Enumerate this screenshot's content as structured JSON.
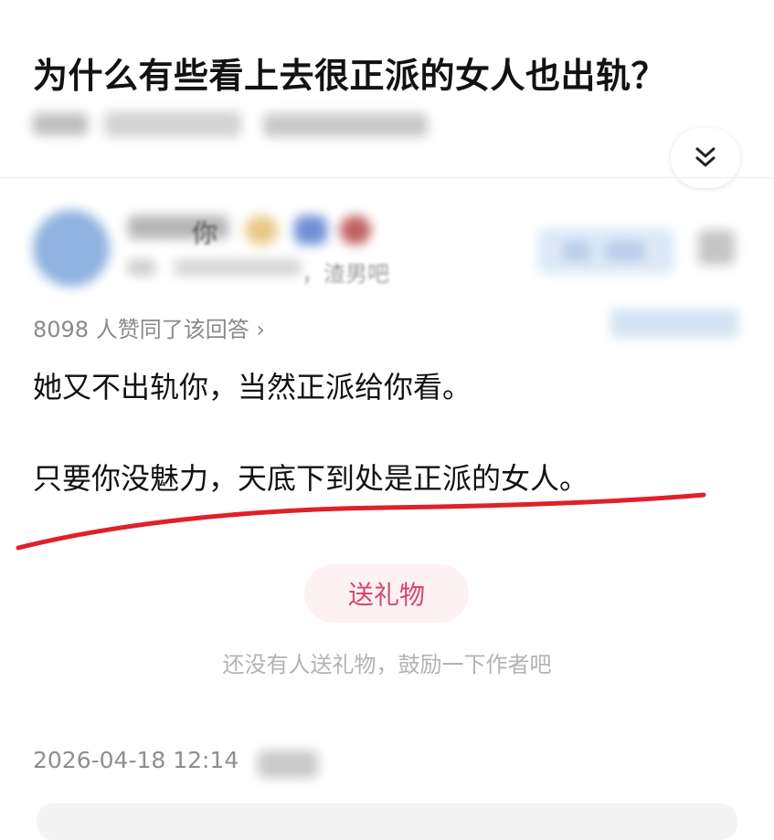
{
  "question": {
    "title": "为什么有些看上去很正派的女人也出轨？"
  },
  "expand_icon": "double-chevron-down",
  "author": {
    "name_fragment": "你",
    "bio_fragment": "，渣男吧"
  },
  "answer": {
    "upvote_text": "8098 人赞同了该回答 ›",
    "paragraphs": [
      "她又不出轨你，当然正派给你看。",
      "只要你没魅力，天底下到处是正派的女人。"
    ],
    "underline_color": "#e0202a"
  },
  "gift": {
    "button_label": "送礼物",
    "hint": "还没有人送礼物，鼓励一下作者吧"
  },
  "footer": {
    "timestamp": "2026-04-18 12:14"
  }
}
